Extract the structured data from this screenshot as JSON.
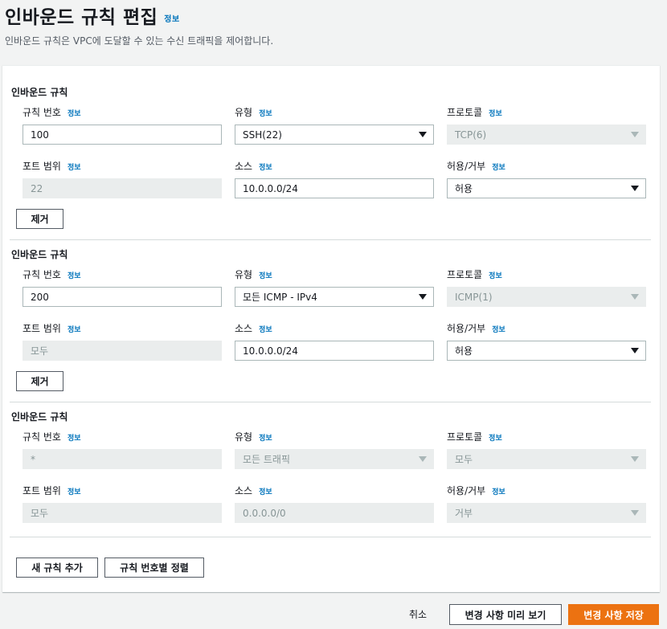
{
  "header": {
    "title": "인바운드 규칙 편집",
    "title_info": "정보",
    "description": "인바운드 규칙은 VPC에 도달할 수 있는 수신 트래픽을 제어합니다."
  },
  "labels": {
    "rule_title": "인바운드 규칙",
    "rule_number": "규칙 번호",
    "type": "유형",
    "protocol": "프로토콜",
    "port_range": "포트 범위",
    "source": "소스",
    "allow_deny": "허용/거부",
    "info": "정보",
    "remove": "제거"
  },
  "rules": [
    {
      "rule_number": "100",
      "type": "SSH(22)",
      "protocol": "TCP(6)",
      "port_range": "22",
      "source": "10.0.0.0/24",
      "allow_deny": "허용"
    },
    {
      "rule_number": "200",
      "type": "모든 ICMP - IPv4",
      "protocol": "ICMP(1)",
      "port_range": "모두",
      "source": "10.0.0.0/24",
      "allow_deny": "허용"
    },
    {
      "rule_number": "*",
      "type": "모든 트래픽",
      "protocol": "모두",
      "port_range": "모두",
      "source": "0.0.0.0/0",
      "allow_deny": "거부"
    }
  ],
  "actions": {
    "add_rule": "새 규칙 추가",
    "sort_rules": "규칙 번호별 정렬",
    "cancel": "취소",
    "preview": "변경 사항 미리 보기",
    "save": "변경 사항 저장"
  },
  "colors": {
    "accent": "#ec7211",
    "link": "#0073bb"
  }
}
